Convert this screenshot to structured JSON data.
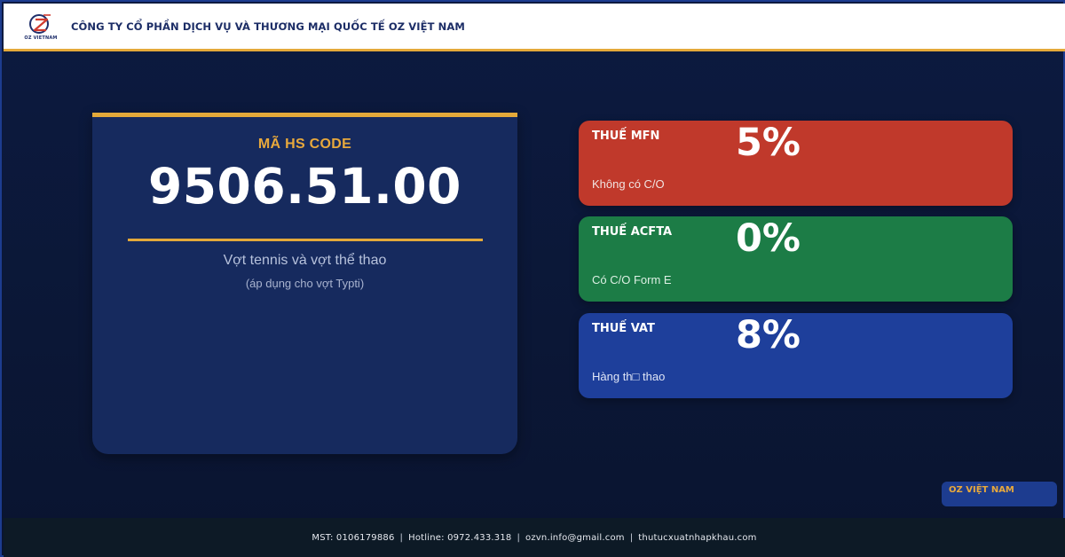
{
  "header": {
    "logo_text": "OZ VIETNAM",
    "company_name": "CÔNG TY CỔ PHẦN DỊCH VỤ VÀ THƯƠNG MẠI QUỐC TẾ OZ VIỆT NAM"
  },
  "hs_card": {
    "label": "MÃ HS CODE",
    "code": "9506.51.00",
    "description": "Vợt tennis và vợt thể thao",
    "note": "(áp dụng cho vợt Typti)"
  },
  "taxes": [
    {
      "title": "THUẾ MFN",
      "rate": "5%",
      "subtitle": "Không có C/O",
      "color": "#c0392b"
    },
    {
      "title": "THUẾ ACFTA",
      "rate": "0%",
      "subtitle": "Có C/O Form E",
      "color": "#1c7c46"
    },
    {
      "title": "THUẾ VAT",
      "rate": "8%",
      "subtitle": "Hàng th□ thao",
      "color": "#1e3f9b"
    }
  ],
  "brand_tag": "OZ VIỆT NAM",
  "footer": {
    "mst": "MST: 0106179886",
    "hotline": "Hotline: 0972.433.318",
    "email": "ozvn.info@gmail.com",
    "website": "thutucxuatnhapkhau.com",
    "separator": "|"
  },
  "colors": {
    "accent": "#e4a93a",
    "background": "#0c1838",
    "card": "#162a5e"
  }
}
